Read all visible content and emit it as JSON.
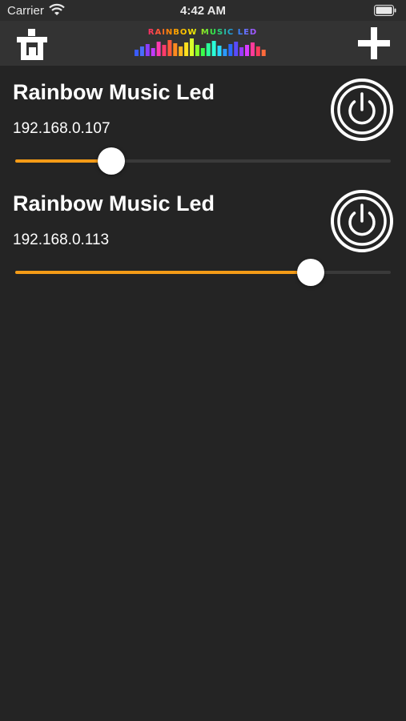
{
  "status_bar": {
    "carrier": "Carrier",
    "time": "4:42 AM",
    "wifi_icon": "wifi-icon",
    "battery_icon": "battery-icon"
  },
  "nav": {
    "left_icon": "remove-device-icon",
    "logo_text": "RAINBOW MUSIC LED",
    "add_icon": "plus-icon"
  },
  "devices": [
    {
      "name": "Rainbow Music Led",
      "ip": "192.168.0.107",
      "brightness": 0.255
    },
    {
      "name": "Rainbow Music Led",
      "ip": "192.168.0.113",
      "brightness": 0.787
    }
  ],
  "colors": {
    "background": "#242424",
    "nav_background": "#333333",
    "slider_fill": "#f49b17",
    "slider_track": "#3a3a3a"
  }
}
